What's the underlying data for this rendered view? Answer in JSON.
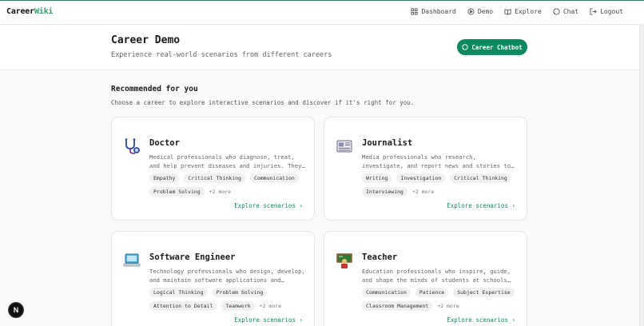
{
  "app": {
    "logo_part1": "Career",
    "logo_part2": "Wiki",
    "brand_color": "#38a169",
    "accent_color": "#0f8a5f"
  },
  "nav": [
    {
      "label": "Dashboard",
      "icon": "grid-icon"
    },
    {
      "label": "Demo",
      "icon": "play-circle-icon"
    },
    {
      "label": "Explore",
      "icon": "book-icon"
    },
    {
      "label": "Chat",
      "icon": "chat-bubble-icon"
    },
    {
      "label": "Logout",
      "icon": "logout-icon"
    }
  ],
  "header": {
    "title": "Career Demo",
    "subtitle": "Experience real-world scenarios from different careers",
    "chat_button": "Career Chatbot"
  },
  "recommended": {
    "title": "Recommended for you",
    "subtitle": "Choose a career to explore interactive scenarios and discover if it's right for you."
  },
  "cards": [
    {
      "title": "Doctor",
      "icon": "stethoscope-icon",
      "description": "Medical professionals who diagnose, treat, and help prevent diseases and injuries. They work in hospitals, clinics and practices.",
      "tags": [
        "Empathy",
        "Critical Thinking",
        "Communication",
        "Problem Solving"
      ],
      "more": "+2 more",
      "link": "Explore scenarios"
    },
    {
      "title": "Journalist",
      "icon": "newspaper-icon",
      "description": "Media professionals who research, investigate, and report news and stories to the public through various media.",
      "tags": [
        "Writing",
        "Investigation",
        "Critical Thinking",
        "Interviewing"
      ],
      "more": "+2 more",
      "link": "Explore scenarios"
    },
    {
      "title": "Software Engineer",
      "icon": "computer-icon",
      "description": "Technology professionals who design, develop, and maintain software applications and systems.",
      "tags": [
        "Logical Thinking",
        "Problem Solving",
        "Attention to Detail",
        "Teamwork"
      ],
      "more": "+2 more",
      "link": "Explore scenarios"
    },
    {
      "title": "Teacher",
      "icon": "teacher-icon",
      "description": "Education professionals who inspire, guide, and shape the minds of students at schools and universities.",
      "tags": [
        "Communication",
        "Patience",
        "Subject Expertise",
        "Classroom Management"
      ],
      "more": "+2 more",
      "link": "Explore scenarios"
    }
  ],
  "fab": {
    "label": "N"
  }
}
